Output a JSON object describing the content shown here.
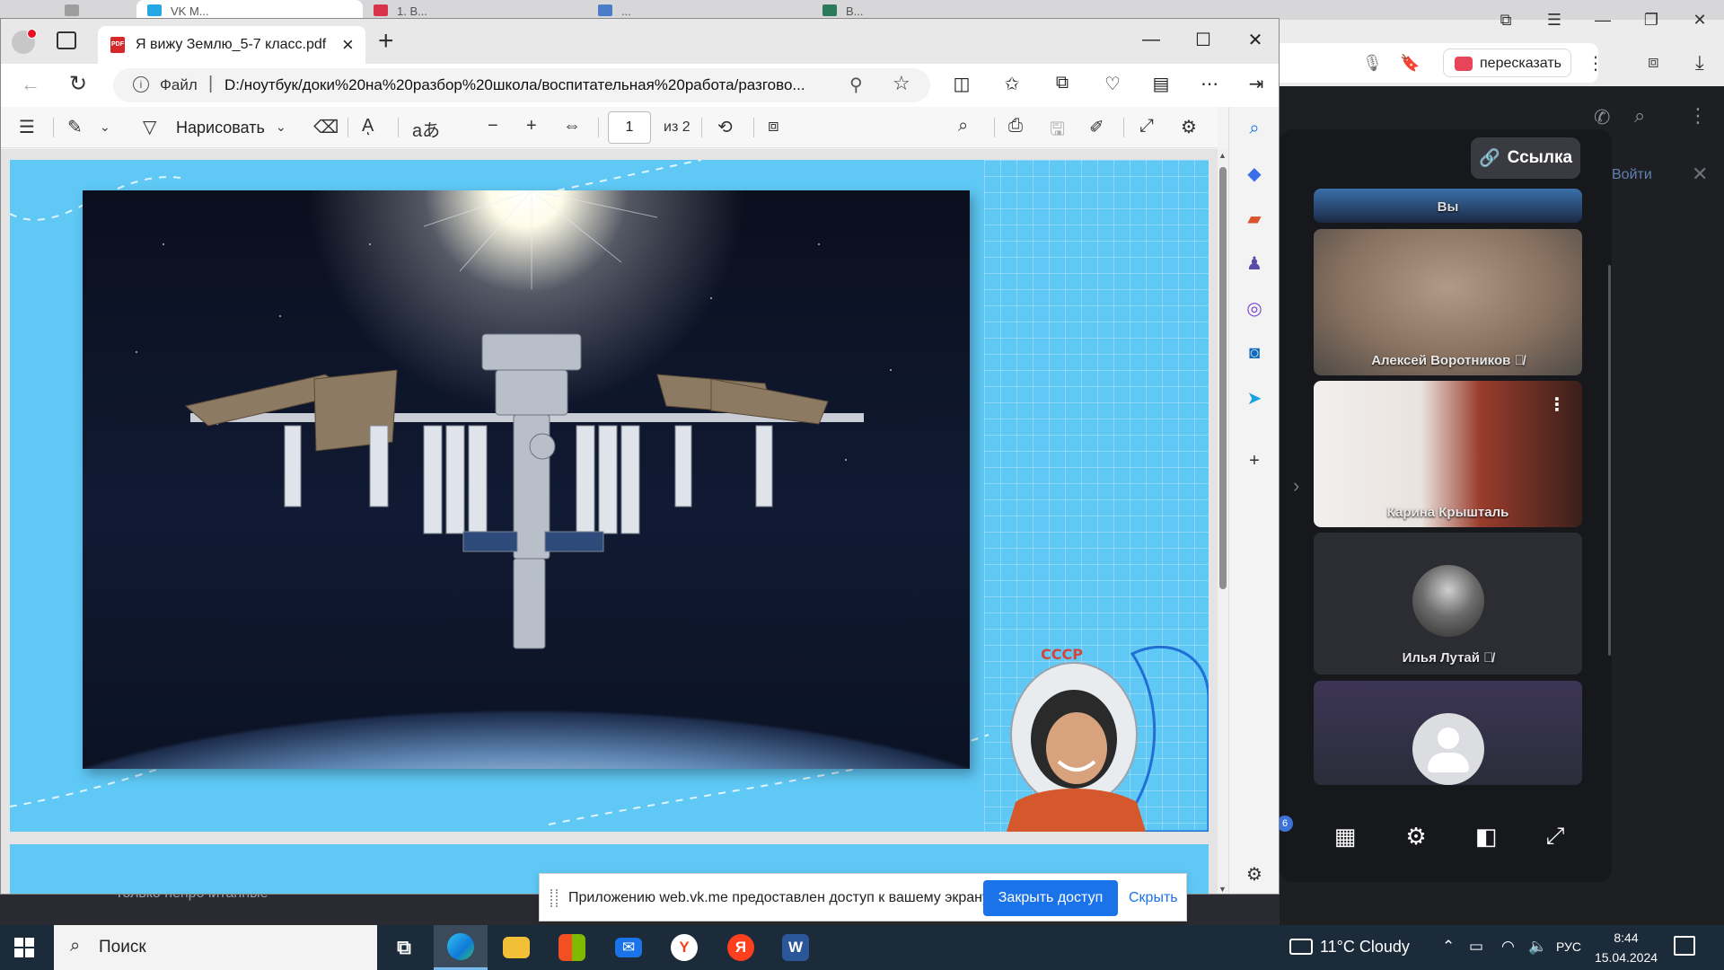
{
  "background_browser": {
    "tabs": [
      {
        "label": "",
        "color": "#9e9e9e"
      },
      {
        "label": "VK M...",
        "color": "#27a6e5"
      },
      {
        "label": "1. В...",
        "color": "#d8334a"
      },
      {
        "label": "...",
        "color": "#4a7dc9"
      },
      {
        "label": "В...",
        "color": "#2b7a5b"
      }
    ],
    "retell_label": "пересказать",
    "retell_badge": "",
    "login_label": "Войти",
    "unread_label": "Только непрочитанные"
  },
  "vk_call": {
    "link_button_label": "Ссылка",
    "participants": [
      {
        "name": "Вы"
      },
      {
        "name": "Алексей Воротников"
      },
      {
        "name": "Карина Крышталь"
      },
      {
        "name": "Илья Лутай"
      },
      {
        "name": ""
      }
    ],
    "badge_count": "6",
    "controls": [
      {
        "icon": "grid-icon"
      },
      {
        "icon": "gear-icon"
      },
      {
        "icon": "layout-icon"
      },
      {
        "icon": "fullscreen-icon"
      }
    ]
  },
  "edge": {
    "tab_title": "Я вижу Землю_5-7 класс.pdf",
    "address_scheme_label": "Файл",
    "address_url": "D:/ноутбук/доки%20на%20разбор%20школа/воспитательная%20работа/разгово...",
    "pdf_toolbar": {
      "draw_label": "Нарисовать",
      "page_current": "1",
      "page_total_label": "из 2"
    },
    "pdf_content": {
      "slide_photo": "iss-over-earth-photo",
      "cosmonaut_image": "gagarin-portrait",
      "helmet_text": "СССР"
    }
  },
  "share_bar": {
    "message": "Приложению web.vk.me предоставлен доступ к вашему экрану.",
    "stop_label": "Закрыть доступ",
    "hide_label": "Скрыть"
  },
  "taskbar": {
    "search_label": "Поиск",
    "weather": "11°C  Cloudy",
    "language": "РУС",
    "time": "8:44",
    "date": "15.04.2024",
    "apps": [
      {
        "name": "task-view",
        "color": "#1c2b3a"
      },
      {
        "name": "edge",
        "color": "#0f7ad8"
      },
      {
        "name": "file-explorer",
        "color": "#f2c037"
      },
      {
        "name": "microsoft-store",
        "color": "#3a86d8"
      },
      {
        "name": "mail",
        "color": "#1a73e8"
      },
      {
        "name": "yandex-browser",
        "color": "#ffffff"
      },
      {
        "name": "yandex",
        "color": "#fc3f1d"
      },
      {
        "name": "word",
        "color": "#2b579a"
      }
    ]
  }
}
